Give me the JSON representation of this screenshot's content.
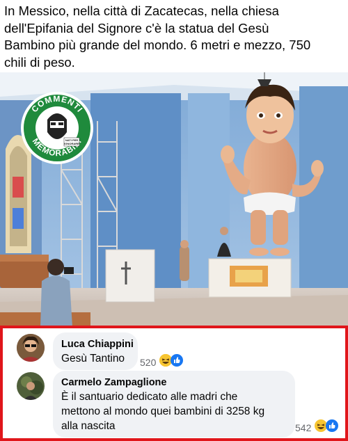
{
  "post": {
    "text_lines": [
      "In Messico, nella città di Zacatecas, nella chiesa",
      "dell'Epifania del Signore c'è la statua del Gesù",
      "Bambino più grande del mondo. 6 metri e mezzo, 750",
      "chili di peso."
    ]
  },
  "photo": {
    "watermark": {
      "top_text": "COMMENTI",
      "bottom_text": "MEMORABILI",
      "small_text_1": "NATI PER",
      "small_text_2": "IGNORARE"
    }
  },
  "comments": [
    {
      "author": "Luca Chiappini",
      "text_lines": [
        "Gesù Tantino"
      ],
      "reaction_count": "520",
      "reactions": [
        "haha-emoji",
        "like-emoji"
      ]
    },
    {
      "author": "Carmelo Zampaglione",
      "text_lines": [
        "È il santuario dedicato alle madri che",
        "mettono al mondo quei bambini di 3258 kg",
        "alla nascita"
      ],
      "reaction_count": "542",
      "reactions": [
        "haha-emoji",
        "like-emoji"
      ]
    }
  ],
  "colors": {
    "highlight_border": "#e0161b",
    "bubble_bg": "#f0f2f5",
    "watermark_green": "#1f8a3c",
    "like_blue": "#1877f2"
  }
}
